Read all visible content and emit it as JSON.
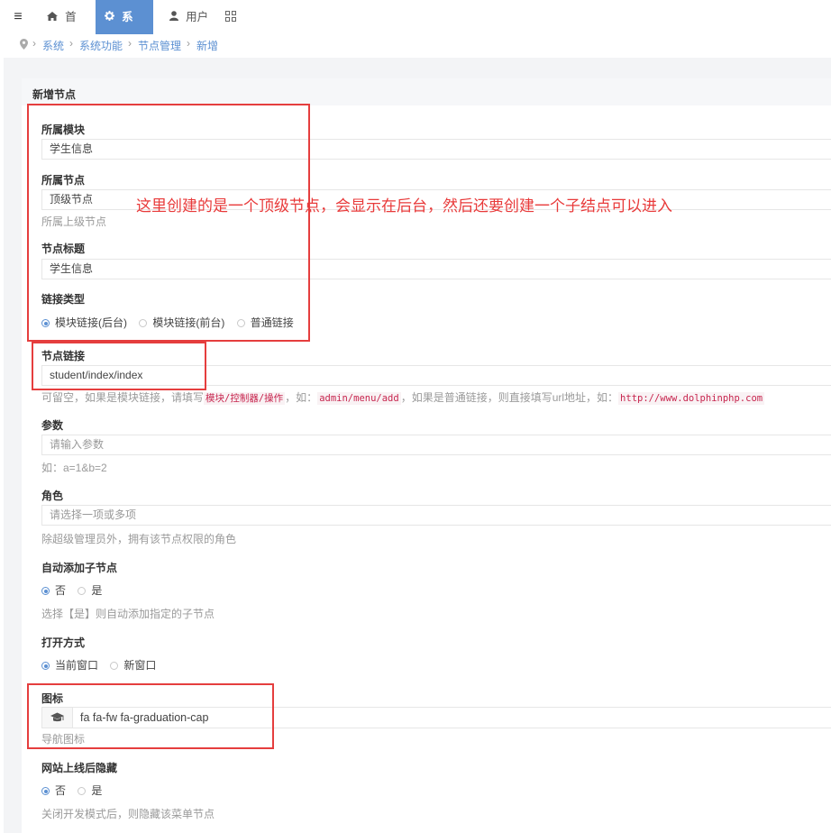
{
  "nav": {
    "items": [
      {
        "icon": "home-icon",
        "label": "首页",
        "active": false
      },
      {
        "icon": "gear-icon",
        "label": "系统",
        "active": true
      },
      {
        "icon": "user-icon",
        "label": "用户",
        "active": false
      }
    ]
  },
  "breadcrumb": [
    "系统",
    "系统功能",
    "节点管理",
    "新增"
  ],
  "panel": {
    "title": "新增节点"
  },
  "annotation": "这里创建的是一个顶级节点，会显示在后台，然后还要创建一个子结点可以进入",
  "form": {
    "module": {
      "label": "所属模块",
      "value": "学生信息"
    },
    "parent": {
      "label": "所属节点",
      "value": "顶级节点",
      "help": "所属上级节点"
    },
    "title": {
      "label": "节点标题",
      "value": "学生信息"
    },
    "link_type": {
      "label": "链接类型",
      "options": [
        "模块链接(后台)",
        "模块链接(前台)",
        "普通链接"
      ],
      "selected": 0
    },
    "url": {
      "label": "节点链接",
      "value": "student/index/index",
      "help_1": "可留空，如果是模块链接，请填写",
      "help_code_1": "模块/控制器/操作",
      "help_2": "，如：",
      "help_code_2": "admin/menu/add",
      "help_3": "，如果是普通链接，则直接填写url地址，如：",
      "help_code_3": "http://www.dolphinphp.com"
    },
    "params": {
      "label": "参数",
      "placeholder": "请输入参数",
      "help": "如：a=1&b=2"
    },
    "role": {
      "label": "角色",
      "placeholder": "请选择一项或多项",
      "help": "除超级管理员外，拥有该节点权限的角色"
    },
    "auto_add": {
      "label": "自动添加子节点",
      "options": [
        "否",
        "是"
      ],
      "selected": 0,
      "help": "选择【是】则自动添加指定的子节点"
    },
    "target": {
      "label": "打开方式",
      "options": [
        "当前窗口",
        "新窗口"
      ],
      "selected": 0
    },
    "icon": {
      "label": "图标",
      "addon_icon": "graduation-cap-icon",
      "value": "fa fa-fw fa-graduation-cap",
      "help": "导航图标"
    },
    "online_hide": {
      "label": "网站上线后隐藏",
      "options": [
        "否",
        "是"
      ],
      "selected": 0,
      "help": "关闭开发模式后，则隐藏该菜单节点"
    }
  }
}
